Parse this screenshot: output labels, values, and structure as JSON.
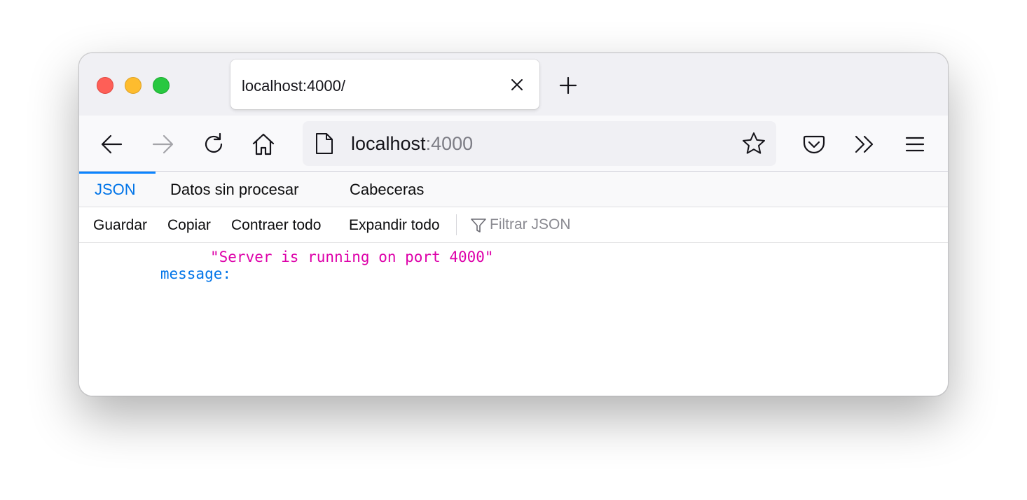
{
  "browser": {
    "tab_title": "localhost:4000/",
    "url_host": "localhost",
    "url_port": ":4000"
  },
  "icons": {
    "close": "close-icon",
    "new_tab": "plus-icon",
    "back": "arrow-left-icon",
    "forward": "arrow-right-icon",
    "reload": "reload-icon",
    "home": "home-icon",
    "page": "page-icon",
    "bookmark": "star-icon",
    "pocket": "pocket-icon",
    "overflow": "chevrons-right-icon",
    "menu": "hamburger-menu-icon",
    "filter": "filter-icon"
  },
  "viewer": {
    "tabs": [
      {
        "label": "JSON",
        "active": true
      },
      {
        "label": "Datos sin procesar",
        "active": false
      },
      {
        "label": "Cabeceras",
        "active": false
      }
    ],
    "toolbar": {
      "save": "Guardar",
      "copy": "Copiar",
      "collapse_all": "Contraer todo",
      "expand_all": "Expandir todo",
      "filter_placeholder": "Filtrar JSON"
    },
    "rows": [
      {
        "key": "message:",
        "value": "\"Server is running on port 4000\""
      }
    ]
  },
  "colors": {
    "accent": "#0a84ff",
    "json_key": "#0074e8",
    "json_string": "#dd00a9"
  }
}
